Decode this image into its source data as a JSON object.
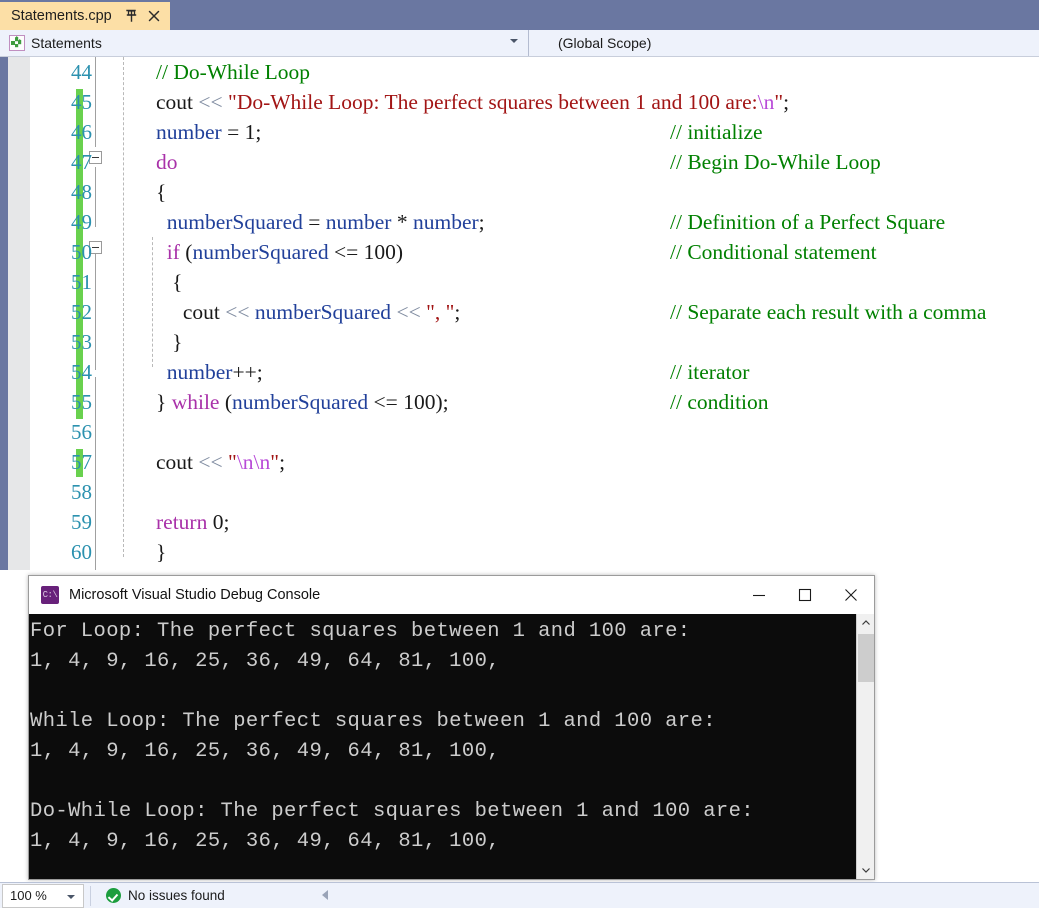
{
  "tab": {
    "title": "Statements.cpp",
    "pin_icon": "pin-icon",
    "close_icon": "close-icon"
  },
  "navbar": {
    "left_icon": "class-members-icon",
    "left_text": "Statements",
    "left_caret": "chevron-down-icon",
    "right_text": "(Global Scope)"
  },
  "editor": {
    "line_numbers": [
      "44",
      "45",
      "46",
      "47",
      "48",
      "49",
      "50",
      "51",
      "52",
      "53",
      "54",
      "55",
      "56",
      "57",
      "58",
      "59",
      "60"
    ],
    "lines": [
      {
        "n": "44",
        "code_html": "<span class=\"cm\">// Do-While Loop</span>",
        "comment_html": ""
      },
      {
        "n": "45",
        "code_html": "<span class=\"pl\">cout </span><span class=\"op\">&lt;&lt;</span><span class=\"str\"> \"Do-While Loop: The perfect squares between 1 and 100 are:</span><span class=\"esc\">\\n</span><span class=\"str\">\"</span><span class=\"pl\">;</span>",
        "comment_html": ""
      },
      {
        "n": "46",
        "code_html": "<span class=\"id\">number</span><span class=\"pl\"> = </span><span class=\"num\">1</span><span class=\"pl\">;</span>",
        "comment_html": "<span class=\"cm\">// initialize</span>"
      },
      {
        "n": "47",
        "code_html": "<span class=\"k\">do</span>",
        "comment_html": "<span class=\"cm\">// Begin Do-While Loop</span>"
      },
      {
        "n": "48",
        "code_html": "<span class=\"pl\">{</span>",
        "comment_html": ""
      },
      {
        "n": "49",
        "code_html": "<span class=\"pl\">  </span><span class=\"id\">numberSquared</span><span class=\"pl\"> = </span><span class=\"id\">number</span><span class=\"pl\"> * </span><span class=\"id\">number</span><span class=\"pl\">;</span>",
        "comment_html": "<span class=\"cm\">// Definition of a Perfect Square</span>"
      },
      {
        "n": "50",
        "code_html": "<span class=\"pl\">  </span><span class=\"k\">if</span><span class=\"pl\"> (</span><span class=\"id\">numberSquared</span><span class=\"pl\"> &lt;= </span><span class=\"num\">100</span><span class=\"pl\">)</span>",
        "comment_html": "<span class=\"cm\">// Conditional statement</span>"
      },
      {
        "n": "51",
        "code_html": "<span class=\"pl\">   {</span>",
        "comment_html": ""
      },
      {
        "n": "52",
        "code_html": "<span class=\"pl\">     cout </span><span class=\"op\">&lt;&lt;</span><span class=\"pl\"> </span><span class=\"id\">numberSquared</span><span class=\"pl\"> </span><span class=\"op\">&lt;&lt;</span><span class=\"str\"> \", \"</span><span class=\"pl\">;</span>",
        "comment_html": "<span class=\"cm\">// Separate each result with a comma</span>"
      },
      {
        "n": "53",
        "code_html": "<span class=\"pl\">   }</span>",
        "comment_html": ""
      },
      {
        "n": "54",
        "code_html": "<span class=\"pl\">  </span><span class=\"id\">number</span><span class=\"pl\">++;</span>",
        "comment_html": "<span class=\"cm\">// iterator</span>"
      },
      {
        "n": "55",
        "code_html": "<span class=\"pl\">} </span><span class=\"k\">while</span><span class=\"pl\"> (</span><span class=\"id\">numberSquared</span><span class=\"pl\"> &lt;= </span><span class=\"num\">100</span><span class=\"pl\">);</span>",
        "comment_html": "<span class=\"cm\">// condition</span>"
      },
      {
        "n": "56",
        "code_html": "",
        "comment_html": ""
      },
      {
        "n": "57",
        "code_html": "<span class=\"pl\">cout </span><span class=\"op\">&lt;&lt;</span><span class=\"str\"> \"</span><span class=\"esc\">\\n\\n</span><span class=\"str\">\"</span><span class=\"pl\">;</span>",
        "comment_html": ""
      },
      {
        "n": "58",
        "code_html": "",
        "comment_html": ""
      },
      {
        "n": "59",
        "code_html": "<span class=\"k\">return</span><span class=\"pl\"> </span><span class=\"num\">0</span><span class=\"pl\">;</span>",
        "comment_html": ""
      },
      {
        "n": "60",
        "code_html": "<span class=\"pl\">}</span>",
        "comment_html": ""
      }
    ],
    "change_bar_color": "#69d14e",
    "line_number_color": "#2b91af",
    "comment_color": "#008000",
    "keyword_color": "#a931a9",
    "string_color": "#a21515",
    "identifier_color": "#21409a"
  },
  "console": {
    "title": "Microsoft Visual Studio Debug Console",
    "icon": "visual-studio-console-icon",
    "minimize_icon": "minimize-icon",
    "maximize_icon": "maximize-icon",
    "close_icon": "close-icon",
    "output": "For Loop: The perfect squares between 1 and 100 are:\n1, 4, 9, 16, 25, 36, 49, 64, 81, 100,\n\nWhile Loop: The perfect squares between 1 and 100 are:\n1, 4, 9, 16, 25, 36, 49, 64, 81, 100,\n\nDo-While Loop: The perfect squares between 1 and 100 are:\n1, 4, 9, 16, 25, 36, 49, 64, 81, 100,",
    "background": "#0c0c0c",
    "foreground": "#cccccc",
    "scroll_up_icon": "chevron-up-icon",
    "scroll_down_icon": "chevron-down-icon"
  },
  "statusbar": {
    "zoom": "100 %",
    "zoom_caret": "chevron-down-icon",
    "issues_icon": "success-check-icon",
    "issues_text": "No issues found",
    "nav_icon": "arrow-left-icon"
  }
}
